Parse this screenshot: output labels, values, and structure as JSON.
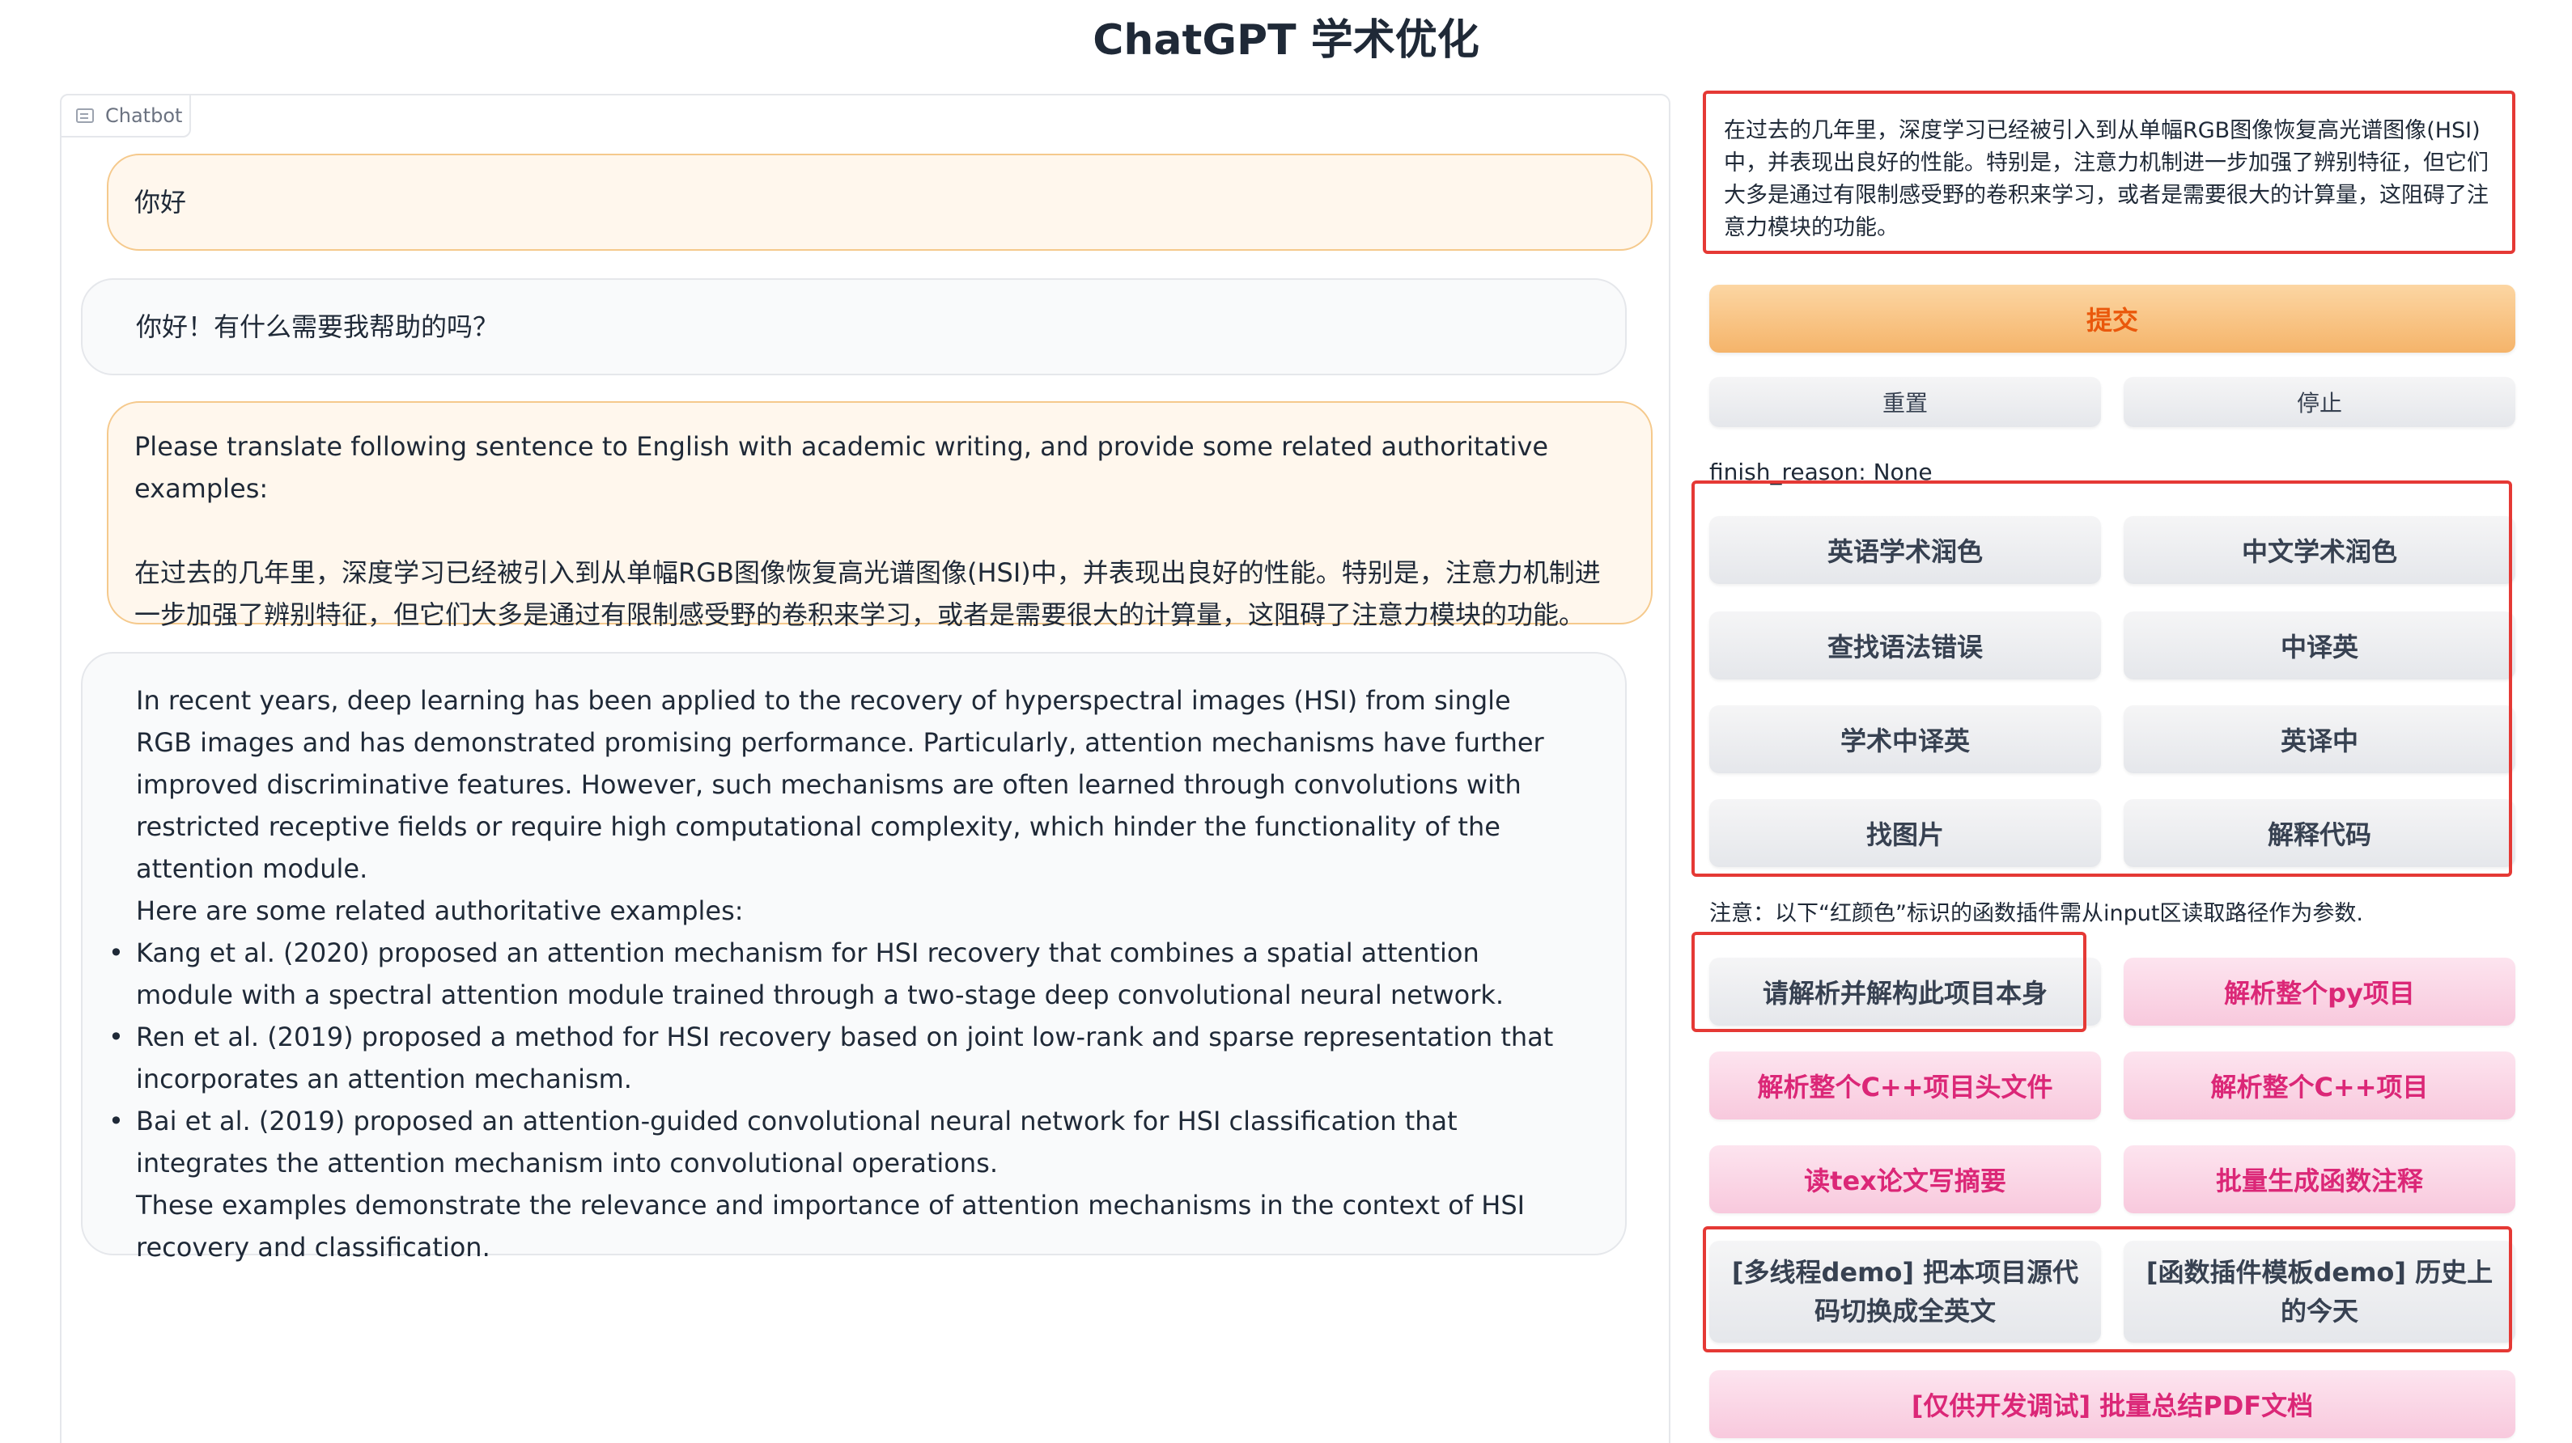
{
  "page": {
    "title": "ChatGPT 学术优化"
  },
  "chatbot": {
    "label": "Chatbot",
    "messages": [
      {
        "role": "user",
        "text": "你好"
      },
      {
        "role": "assistant",
        "text": "你好！有什么需要我帮助的吗？"
      },
      {
        "role": "user",
        "line1": "Please translate following sentence to English with academic writing, and provide some related authoritative examples:",
        "line2": "在过去的几年里，深度学习已经被引入到从单幅RGB图像恢复高光谱图像(HSI)中，并表现出良好的性能。特别是，注意力机制进一步加强了辨别特征，但它们大多是通过有限制感受野的卷积来学习，或者是需要很大的计算量，这阻碍了注意力模块的功能。"
      },
      {
        "role": "assistant",
        "para1": "In recent years, deep learning has been applied to the recovery of hyperspectral images (HSI) from single RGB images and has demonstrated promising performance. Particularly, attention mechanisms have further improved discriminative features. However, such mechanisms are often learned through convolutions with restricted receptive fields or require high computational complexity, which hinder the functionality of the attention module.",
        "para2": "Here are some related authoritative examples:",
        "bullets": [
          "Kang et al. (2020) proposed an attention mechanism for HSI recovery that combines a spatial attention module with a spectral attention module trained through a two-stage deep convolutional neural network.",
          "Ren et al. (2019) proposed a method for HSI recovery based on joint low-rank and sparse representation that incorporates an attention mechanism.",
          "Bai et al. (2019) proposed an attention-guided convolutional neural network for HSI classification that integrates the attention mechanism into convolutional operations."
        ],
        "para3": "These examples demonstrate the relevance and importance of attention mechanisms in the context of HSI recovery and classification."
      }
    ]
  },
  "controls": {
    "input_value": "在过去的几年里，深度学习已经被引入到从单幅RGB图像恢复高光谱图像(HSI)中，并表现出良好的性能。特别是，注意力机制进一步加强了辨别特征，但它们大多是通过有限制感受野的卷积来学习，或者是需要很大的计算量，这阻碍了注意力模块的功能。",
    "submit": "提交",
    "reset": "重置",
    "stop": "停止",
    "finish_reason": "finish_reason: None",
    "core_buttons": [
      "英语学术润色",
      "中文学术润色",
      "查找语法错误",
      "中译英",
      "学术中译英",
      "英译中",
      "找图片",
      "解释代码"
    ],
    "note": "注意：以下“红颜色”标识的函数插件需从input区读取路径作为参数.",
    "plugin_buttons": [
      "请解析并解构此项目本身",
      "解析整个py项目",
      "解析整个C++项目头文件",
      "解析整个C++项目",
      "读tex论文写摘要",
      "批量生成函数注释",
      "[多线程demo] 把本项目源代码切换成全英文",
      "[函数插件模板demo] 历史上的今天",
      "[仅供开发调试] 批量总结PDF文档"
    ]
  },
  "colors": {
    "highlight": "#e53935",
    "accent": "#ea580c",
    "plugin": "#db2777"
  }
}
